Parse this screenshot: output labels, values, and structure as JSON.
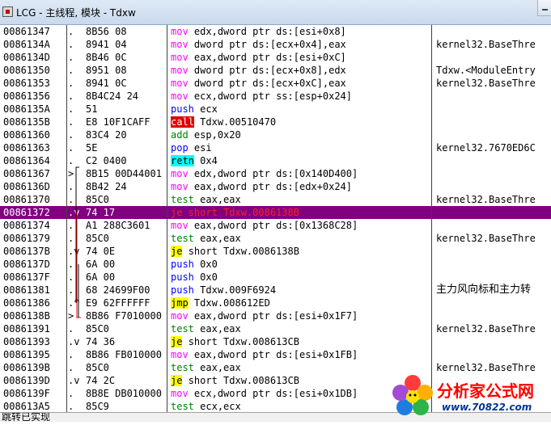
{
  "window": {
    "title": "LCG - 主线程, 模块 - Tdxw"
  },
  "rows": [
    {
      "addr": "00861347",
      "mark": ".",
      "bytes": "8B56 08",
      "mn": "mov",
      "cls": "mov",
      "ops": "edx,dword ptr ds:[esi+0x8]",
      "cmt": ""
    },
    {
      "addr": "0086134A",
      "mark": ".",
      "bytes": "8941 04",
      "mn": "mov",
      "cls": "mov",
      "ops": "dword ptr ds:[ecx+0x4],eax",
      "cmt": "kernel32.BaseThre"
    },
    {
      "addr": "0086134D",
      "mark": ".",
      "bytes": "8B46 0C",
      "mn": "mov",
      "cls": "mov",
      "ops": "eax,dword ptr ds:[esi+0xC]",
      "cmt": ""
    },
    {
      "addr": "00861350",
      "mark": ".",
      "bytes": "8951 08",
      "mn": "mov",
      "cls": "mov",
      "ops": "dword ptr ds:[ecx+0x8],edx",
      "cmt": "Tdxw.<ModuleEntry"
    },
    {
      "addr": "00861353",
      "mark": ".",
      "bytes": "8941 0C",
      "mn": "mov",
      "cls": "mov",
      "ops": "dword ptr ds:[ecx+0xC],eax",
      "cmt": "kernel32.BaseThre"
    },
    {
      "addr": "00861356",
      "mark": ".",
      "bytes": "8B4C24 24",
      "mn": "mov",
      "cls": "mov",
      "ops": "ecx,dword ptr ss:[esp+0x24]",
      "cmt": ""
    },
    {
      "addr": "0086135A",
      "mark": ".",
      "bytes": "51",
      "mn": "push",
      "cls": "push",
      "ops": "ecx",
      "cmt": ""
    },
    {
      "addr": "0086135B",
      "mark": ".",
      "bytes": "E8 10F1CAFF",
      "mn": "call",
      "cls": "call",
      "ops": "Tdxw.00510470",
      "cmt": ""
    },
    {
      "addr": "00861360",
      "mark": ".",
      "bytes": "83C4 20",
      "mn": "add",
      "cls": "add",
      "ops": "esp,0x20",
      "cmt": ""
    },
    {
      "addr": "00861363",
      "mark": ".",
      "bytes": "5E",
      "mn": "pop",
      "cls": "pop",
      "ops": "esi",
      "cmt": "kernel32.7670ED6C"
    },
    {
      "addr": "00861364",
      "mark": ".",
      "bytes": "C2 0400",
      "mn": "retn",
      "cls": "ret",
      "ops": "0x4",
      "cmt": ""
    },
    {
      "addr": "00861367",
      "mark": ">",
      "bytes": "8B15 00D44001",
      "mn": "mov",
      "cls": "mov",
      "ops": "edx,dword ptr ds:[0x140D400]",
      "cmt": ""
    },
    {
      "addr": "0086136D",
      "mark": ".",
      "bytes": "8B42 24",
      "mn": "mov",
      "cls": "mov",
      "ops": "eax,dword ptr ds:[edx+0x24]",
      "cmt": ""
    },
    {
      "addr": "00861370",
      "mark": ".",
      "bytes": "85C0",
      "mn": "test",
      "cls": "test",
      "ops": "eax,eax",
      "cmt": "kernel32.BaseThre"
    },
    {
      "addr": "00861372",
      "mark": ".v",
      "bytes": "74 17",
      "mn": "je",
      "cls": "jcc",
      "ops": "short Tdxw.0086138B",
      "cmt": "",
      "sel": true
    },
    {
      "addr": "00861374",
      "mark": ".",
      "bytes": "A1 288C3601",
      "mn": "mov",
      "cls": "mov",
      "ops": "eax,dword ptr ds:[0x1368C28]",
      "cmt": ""
    },
    {
      "addr": "00861379",
      "mark": ".",
      "bytes": "85C0",
      "mn": "test",
      "cls": "test",
      "ops": "eax,eax",
      "cmt": "kernel32.BaseThre"
    },
    {
      "addr": "0086137B",
      "mark": ".v",
      "bytes": "74 0E",
      "mn": "je",
      "cls": "jcc",
      "ops": "short Tdxw.0086138B",
      "cmt": ""
    },
    {
      "addr": "0086137D",
      "mark": ".",
      "bytes": "6A 00",
      "mn": "push",
      "cls": "push",
      "ops": "0x0",
      "cmt": ""
    },
    {
      "addr": "0086137F",
      "mark": ".",
      "bytes": "6A 00",
      "mn": "push",
      "cls": "push",
      "ops": "0x0",
      "cmt": ""
    },
    {
      "addr": "00861381",
      "mark": ".",
      "bytes": "68 24699F00",
      "mn": "push",
      "cls": "push",
      "ops": "Tdxw.009F6924",
      "cmt": "主力风向标和主力转",
      "cjk": true
    },
    {
      "addr": "00861386",
      "mark": ".^",
      "bytes": "E9 62FFFFFF",
      "mn": "jmp",
      "cls": "jcc",
      "ops": "Tdxw.008612ED",
      "cmt": ""
    },
    {
      "addr": "0086138B",
      "mark": ">",
      "bytes": "8B86 F7010000",
      "mn": "mov",
      "cls": "mov",
      "ops": "eax,dword ptr ds:[esi+0x1F7]",
      "cmt": ""
    },
    {
      "addr": "00861391",
      "mark": ".",
      "bytes": "85C0",
      "mn": "test",
      "cls": "test",
      "ops": "eax,eax",
      "cmt": "kernel32.BaseThre"
    },
    {
      "addr": "00861393",
      "mark": ".v",
      "bytes": "74 36",
      "mn": "je",
      "cls": "jcc",
      "ops": "short Tdxw.008613CB",
      "cmt": ""
    },
    {
      "addr": "00861395",
      "mark": ".",
      "bytes": "8B86 FB010000",
      "mn": "mov",
      "cls": "mov",
      "ops": "eax,dword ptr ds:[esi+0x1FB]",
      "cmt": ""
    },
    {
      "addr": "0086139B",
      "mark": ".",
      "bytes": "85C0",
      "mn": "test",
      "cls": "test",
      "ops": "eax,eax",
      "cmt": "kernel32.BaseThre"
    },
    {
      "addr": "0086139D",
      "mark": ".v",
      "bytes": "74 2C",
      "mn": "je",
      "cls": "jcc",
      "ops": "short Tdxw.008613CB",
      "cmt": ""
    },
    {
      "addr": "0086139F",
      "mark": ".",
      "bytes": "8B8E DB010000",
      "mn": "mov",
      "cls": "mov",
      "ops": "ecx,dword ptr ds:[esi+0x1DB]",
      "cmt": ""
    },
    {
      "addr": "008613A5",
      "mark": ".",
      "bytes": "85C9",
      "mn": "test",
      "cls": "test",
      "ops": "ecx,ecx",
      "cmt": ""
    }
  ],
  "status": {
    "text": "跳转已实现"
  },
  "watermark": {
    "text": "分析家公式网",
    "url": "www.70822.com"
  }
}
